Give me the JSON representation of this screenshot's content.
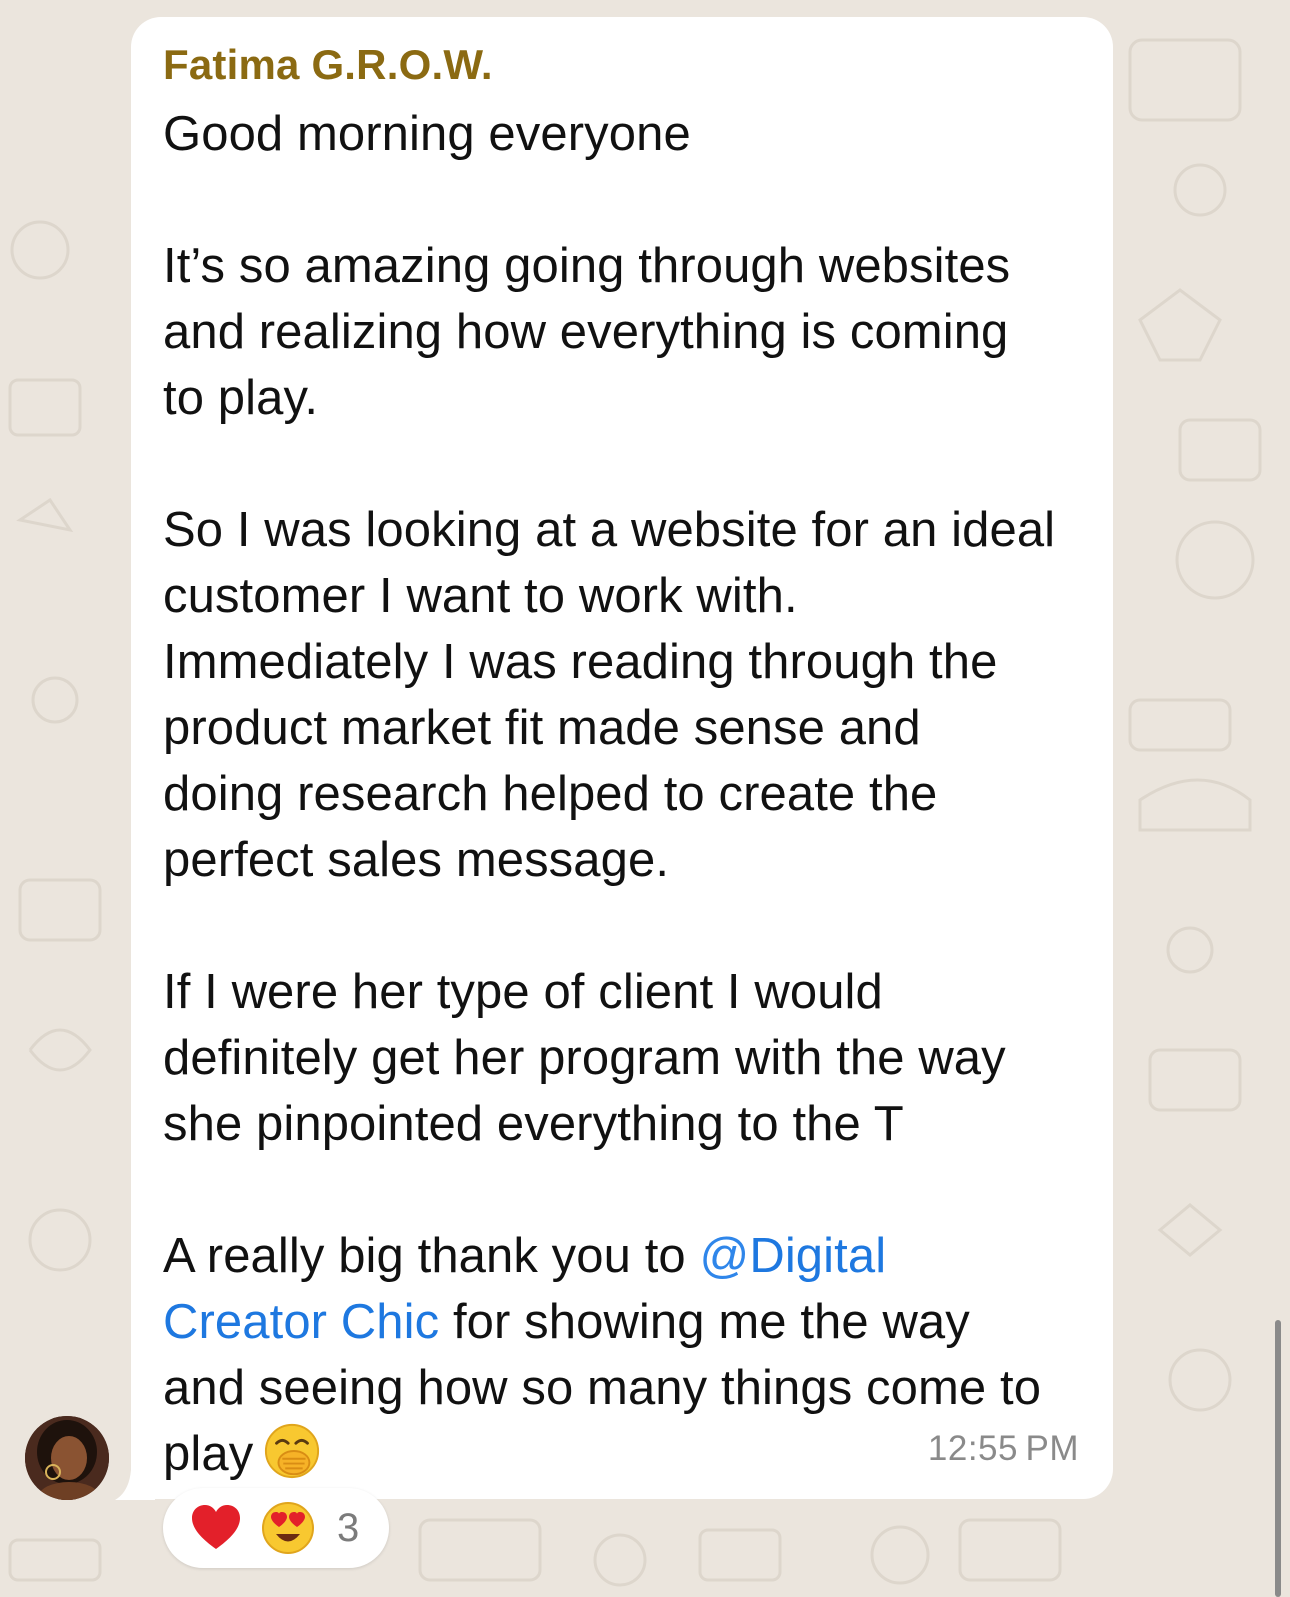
{
  "message": {
    "sender": "Fatima G.R.O.W.",
    "paragraphs": [
      [
        "Good morning everyone"
      ],
      [
        "It’s so amazing going through websites",
        "and realizing how everything is coming",
        "to play."
      ],
      [
        "So I was looking at a website for an ideal",
        "customer I want to work with.",
        "Immediately I was reading through the",
        "product market fit made sense and",
        "doing research helped to create the",
        "perfect sales message."
      ],
      [
        "If I were her type of client I would",
        "definitely get her program with the way",
        "she pinpointed everything to the T"
      ]
    ],
    "thanks": {
      "before_mention": "A really big thank you to ",
      "mention_at": "@",
      "mention_part1": "Digital",
      "mention_part2": "Creator Chic",
      "after_mention_line": " for showing me the way",
      "line3": "and seeing how so many things come to",
      "line4": "play"
    },
    "inline_emoji": "hand-over-mouth-emoji",
    "time": "12:55 PM"
  },
  "reactions": {
    "emojis": [
      "red-heart",
      "heart-eyes"
    ],
    "count": "3"
  },
  "colors": {
    "sender": "#8b6a12",
    "mention": "#1e78e0",
    "background": "#ebe5dd",
    "bubble": "#ffffff"
  }
}
